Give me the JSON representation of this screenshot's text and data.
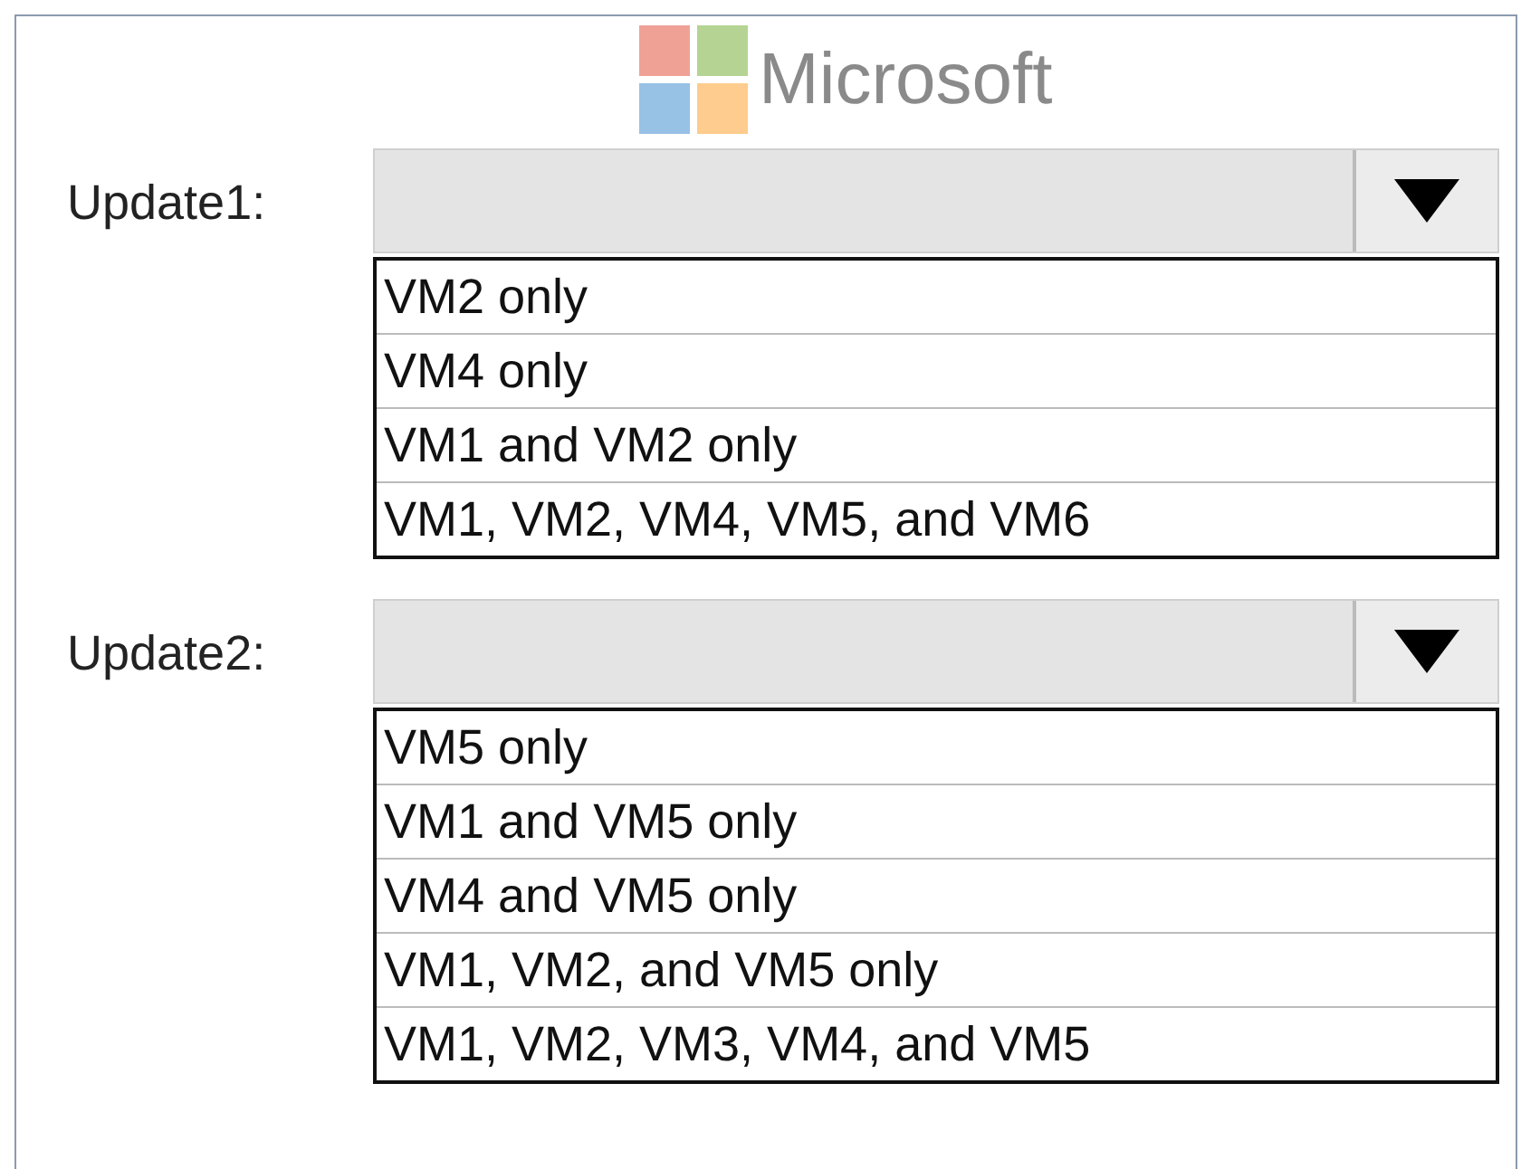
{
  "logo": {
    "text": "Microsoft"
  },
  "questions": [
    {
      "label": "Update1:",
      "options": [
        "VM2 only",
        "VM4 only",
        "VM1 and VM2 only",
        "VM1, VM2, VM4, VM5, and VM6"
      ]
    },
    {
      "label": "Update2:",
      "options": [
        "VM5 only",
        "VM1 and VM5 only",
        "VM4 and VM5 only",
        "VM1, VM2, and VM5 only",
        "VM1, VM2, VM3, VM4, and VM5"
      ]
    }
  ]
}
